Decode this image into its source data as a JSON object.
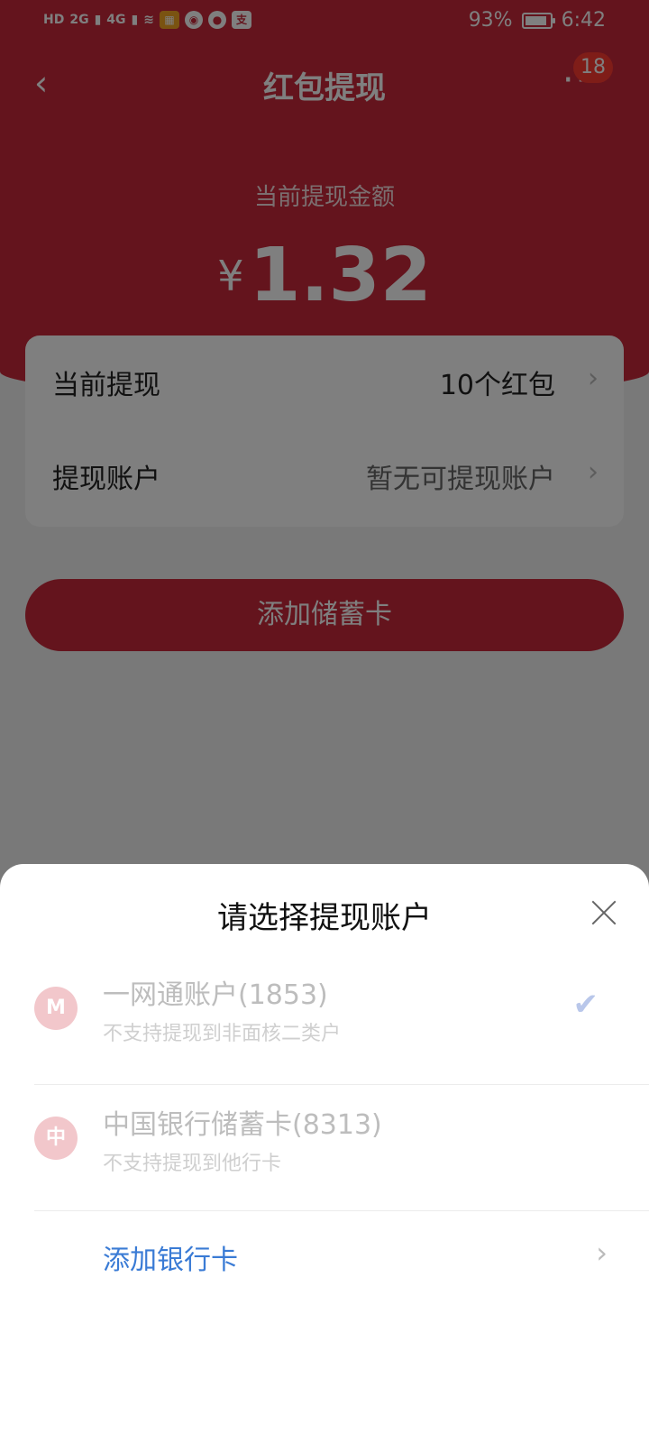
{
  "status_bar": {
    "network_labels": [
      "HD",
      "2G",
      "4G"
    ],
    "battery_percent": "93%",
    "battery_level": 0.93,
    "time": "6:42"
  },
  "nav": {
    "back_icon": "back-chevron-icon",
    "title": "红包提现",
    "more_icon": "more-dots-icon",
    "badge_count": "18"
  },
  "amount": {
    "label": "当前提现金额",
    "currency": "¥",
    "value": "1.32"
  },
  "summary": {
    "rows": [
      {
        "key": "当前提现",
        "value": "10个红包"
      },
      {
        "key": "提现账户",
        "value": "暂无可提现账户"
      }
    ]
  },
  "primary_button": {
    "label": "添加储蓄卡"
  },
  "sheet": {
    "title": "请选择提现账户",
    "accounts": [
      {
        "name": "一网通账户(1853)",
        "note": "不支持提现到非面核二类户",
        "selected": true,
        "logo": "cmb-logo"
      },
      {
        "name": "中国银行储蓄卡(8313)",
        "note": "不支持提现到他行卡",
        "selected": false,
        "logo": "boc-logo"
      }
    ],
    "add_card_label": "添加银行卡"
  },
  "colors": {
    "brand_red": "#c8283a",
    "link_blue": "#3a7bd5",
    "badge_red": "#ff3b30"
  }
}
